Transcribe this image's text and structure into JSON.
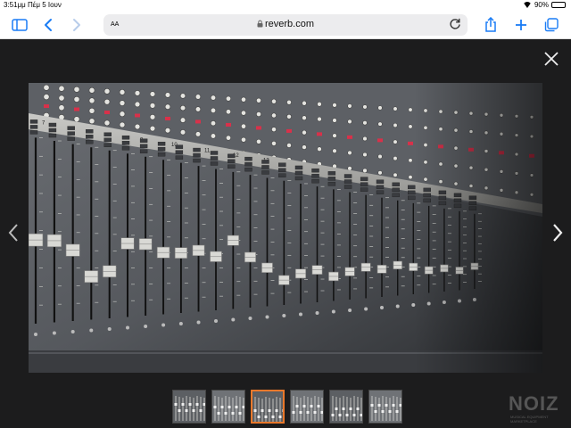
{
  "status_bar": {
    "time": "3:51μμ",
    "date": "Πέμ 5 Ιουν",
    "battery": "90%",
    "battery_level": 0.9
  },
  "browser": {
    "text_size_label": "AA",
    "url": "reverb.com",
    "icons": [
      "sidebar-icon",
      "back-icon",
      "forward-icon",
      "lock-icon",
      "reload-icon",
      "share-icon",
      "new-tab-icon",
      "tabs-icon"
    ]
  },
  "viewer": {
    "thumbnail_count": 6,
    "active_thumbnail": 2,
    "fader_labels": [
      "7",
      "9",
      "10",
      "11",
      "12",
      "13"
    ]
  },
  "watermark": {
    "logo": "NOIZ",
    "tagline": "MUSICAL EQUIPMENT MARKETPLACE"
  },
  "colors": {
    "accent": "#1a7cf5",
    "active_thumb": "#e9782b"
  }
}
